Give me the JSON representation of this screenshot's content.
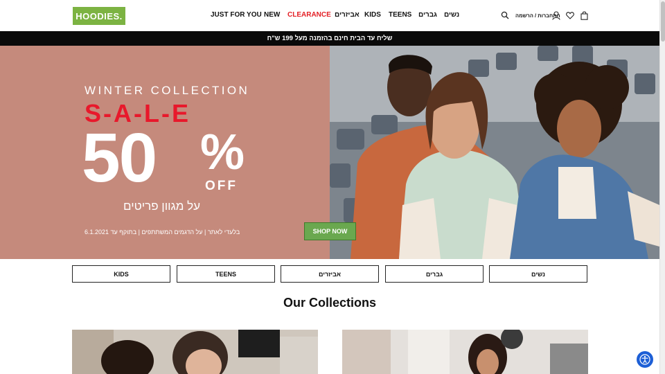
{
  "header": {
    "logo": "HOODIES.",
    "nav": [
      {
        "label": "JUST FOR YOU",
        "name": "nav-just-for-you",
        "red": false
      },
      {
        "label": "NEW",
        "name": "nav-new",
        "red": false
      },
      {
        "label": "CLEARANCE",
        "name": "nav-clearance",
        "red": true
      },
      {
        "label": "אביזרים",
        "name": "nav-accessories",
        "red": false
      },
      {
        "label": "KIDS",
        "name": "nav-kids",
        "red": false
      },
      {
        "label": "TEENS",
        "name": "nav-teens",
        "red": false
      },
      {
        "label": "גברים",
        "name": "nav-men",
        "red": false
      },
      {
        "label": "נשים",
        "name": "nav-women",
        "red": false
      }
    ],
    "login_label": "התחברות / הרשמה",
    "icons": [
      "search-icon",
      "user-icon",
      "heart-icon",
      "bag-icon"
    ]
  },
  "promo": {
    "text": "שליח עד הבית חינם בהזמנה מעל 199 ש\"ח"
  },
  "hero": {
    "winter": "WINTER COLLECTION",
    "sale": "S-A-L-E",
    "percent_value": "50",
    "percent_sign": "%",
    "off": "OFF",
    "hebrew_sub": "על מגוון פריטים",
    "fine_print": "בלעדי לאתר | על הדגמים המשתתפים | בתוקף עד 6.1.2021",
    "cta": "SHOP NOW"
  },
  "categories": [
    {
      "label": "KIDS",
      "name": "category-kids"
    },
    {
      "label": "TEENS",
      "name": "category-teens"
    },
    {
      "label": "אביזרים",
      "name": "category-accessories"
    },
    {
      "label": "גברים",
      "name": "category-men"
    },
    {
      "label": "נשים",
      "name": "category-women"
    }
  ],
  "collections": {
    "title": "Our Collections"
  },
  "colors": {
    "brand": "#7cb342",
    "sale_red": "#e8182b",
    "hero_bg": "#c58a7c",
    "cta": "#6aa84f",
    "accessibility": "#1d5fd6"
  }
}
